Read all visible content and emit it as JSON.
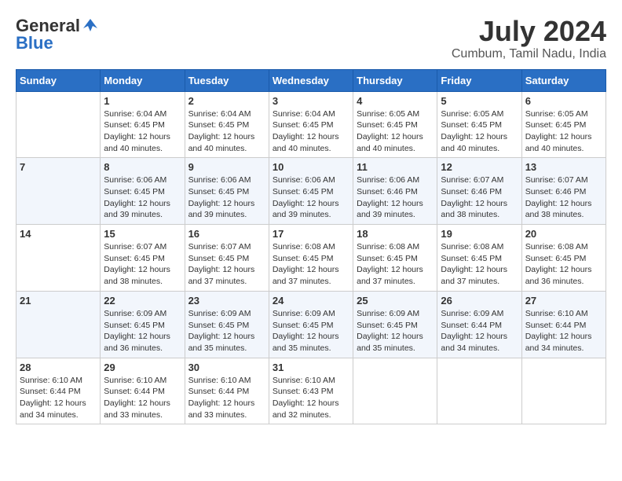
{
  "header": {
    "logo_general": "General",
    "logo_blue": "Blue",
    "month": "July 2024",
    "location": "Cumbum, Tamil Nadu, India"
  },
  "calendar": {
    "days_of_week": [
      "Sunday",
      "Monday",
      "Tuesday",
      "Wednesday",
      "Thursday",
      "Friday",
      "Saturday"
    ],
    "weeks": [
      [
        {
          "day": "",
          "info": ""
        },
        {
          "day": "1",
          "info": "Sunrise: 6:04 AM\nSunset: 6:45 PM\nDaylight: 12 hours\nand 40 minutes."
        },
        {
          "day": "2",
          "info": "Sunrise: 6:04 AM\nSunset: 6:45 PM\nDaylight: 12 hours\nand 40 minutes."
        },
        {
          "day": "3",
          "info": "Sunrise: 6:04 AM\nSunset: 6:45 PM\nDaylight: 12 hours\nand 40 minutes."
        },
        {
          "day": "4",
          "info": "Sunrise: 6:05 AM\nSunset: 6:45 PM\nDaylight: 12 hours\nand 40 minutes."
        },
        {
          "day": "5",
          "info": "Sunrise: 6:05 AM\nSunset: 6:45 PM\nDaylight: 12 hours\nand 40 minutes."
        },
        {
          "day": "6",
          "info": "Sunrise: 6:05 AM\nSunset: 6:45 PM\nDaylight: 12 hours\nand 40 minutes."
        }
      ],
      [
        {
          "day": "7",
          "info": ""
        },
        {
          "day": "8",
          "info": "Sunrise: 6:06 AM\nSunset: 6:45 PM\nDaylight: 12 hours\nand 39 minutes."
        },
        {
          "day": "9",
          "info": "Sunrise: 6:06 AM\nSunset: 6:45 PM\nDaylight: 12 hours\nand 39 minutes."
        },
        {
          "day": "10",
          "info": "Sunrise: 6:06 AM\nSunset: 6:45 PM\nDaylight: 12 hours\nand 39 minutes."
        },
        {
          "day": "11",
          "info": "Sunrise: 6:06 AM\nSunset: 6:46 PM\nDaylight: 12 hours\nand 39 minutes."
        },
        {
          "day": "12",
          "info": "Sunrise: 6:07 AM\nSunset: 6:46 PM\nDaylight: 12 hours\nand 38 minutes."
        },
        {
          "day": "13",
          "info": "Sunrise: 6:07 AM\nSunset: 6:46 PM\nDaylight: 12 hours\nand 38 minutes."
        }
      ],
      [
        {
          "day": "14",
          "info": ""
        },
        {
          "day": "15",
          "info": "Sunrise: 6:07 AM\nSunset: 6:45 PM\nDaylight: 12 hours\nand 38 minutes."
        },
        {
          "day": "16",
          "info": "Sunrise: 6:07 AM\nSunset: 6:45 PM\nDaylight: 12 hours\nand 37 minutes."
        },
        {
          "day": "17",
          "info": "Sunrise: 6:08 AM\nSunset: 6:45 PM\nDaylight: 12 hours\nand 37 minutes."
        },
        {
          "day": "18",
          "info": "Sunrise: 6:08 AM\nSunset: 6:45 PM\nDaylight: 12 hours\nand 37 minutes."
        },
        {
          "day": "19",
          "info": "Sunrise: 6:08 AM\nSunset: 6:45 PM\nDaylight: 12 hours\nand 37 minutes."
        },
        {
          "day": "20",
          "info": "Sunrise: 6:08 AM\nSunset: 6:45 PM\nDaylight: 12 hours\nand 36 minutes."
        }
      ],
      [
        {
          "day": "21",
          "info": ""
        },
        {
          "day": "22",
          "info": "Sunrise: 6:09 AM\nSunset: 6:45 PM\nDaylight: 12 hours\nand 36 minutes."
        },
        {
          "day": "23",
          "info": "Sunrise: 6:09 AM\nSunset: 6:45 PM\nDaylight: 12 hours\nand 35 minutes."
        },
        {
          "day": "24",
          "info": "Sunrise: 6:09 AM\nSunset: 6:45 PM\nDaylight: 12 hours\nand 35 minutes."
        },
        {
          "day": "25",
          "info": "Sunrise: 6:09 AM\nSunset: 6:45 PM\nDaylight: 12 hours\nand 35 minutes."
        },
        {
          "day": "26",
          "info": "Sunrise: 6:09 AM\nSunset: 6:44 PM\nDaylight: 12 hours\nand 34 minutes."
        },
        {
          "day": "27",
          "info": "Sunrise: 6:10 AM\nSunset: 6:44 PM\nDaylight: 12 hours\nand 34 minutes."
        }
      ],
      [
        {
          "day": "28",
          "info": "Sunrise: 6:10 AM\nSunset: 6:44 PM\nDaylight: 12 hours\nand 34 minutes."
        },
        {
          "day": "29",
          "info": "Sunrise: 6:10 AM\nSunset: 6:44 PM\nDaylight: 12 hours\nand 33 minutes."
        },
        {
          "day": "30",
          "info": "Sunrise: 6:10 AM\nSunset: 6:44 PM\nDaylight: 12 hours\nand 33 minutes."
        },
        {
          "day": "31",
          "info": "Sunrise: 6:10 AM\nSunset: 6:43 PM\nDaylight: 12 hours\nand 32 minutes."
        },
        {
          "day": "",
          "info": ""
        },
        {
          "day": "",
          "info": ""
        },
        {
          "day": "",
          "info": ""
        }
      ]
    ]
  }
}
